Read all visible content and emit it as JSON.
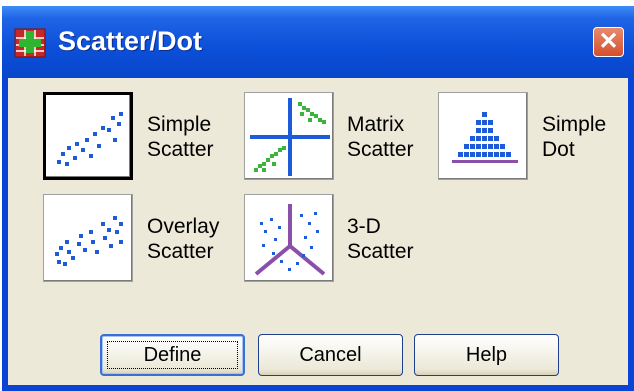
{
  "window": {
    "title": "Scatter/Dot",
    "close_glyph": "✕"
  },
  "icons": {
    "app": "spss-chart-app-icon",
    "close": "close-icon"
  },
  "chart_types": [
    {
      "line1": "Simple",
      "line2": "Scatter",
      "icon": "simple-scatter-icon",
      "selected": true
    },
    {
      "line1": "Matrix",
      "line2": "Scatter",
      "icon": "matrix-scatter-icon",
      "selected": false
    },
    {
      "line1": "Simple",
      "line2": "Dot",
      "icon": "simple-dot-icon",
      "selected": false
    },
    {
      "line1": "Overlay",
      "line2": "Scatter",
      "icon": "overlay-scatter-icon",
      "selected": false
    },
    {
      "line1": "3-D",
      "line2": "Scatter",
      "icon": "3d-scatter-icon",
      "selected": false
    }
  ],
  "buttons": {
    "define": "Define",
    "cancel": "Cancel",
    "help": "Help"
  },
  "colors": {
    "titlebar": "#0a46cc",
    "client": "#ece9d8",
    "close": "#d4502d",
    "blue_marks": "#1e5bd8",
    "green_marks": "#3cb43c",
    "axis_purple": "#8a4fa8"
  }
}
